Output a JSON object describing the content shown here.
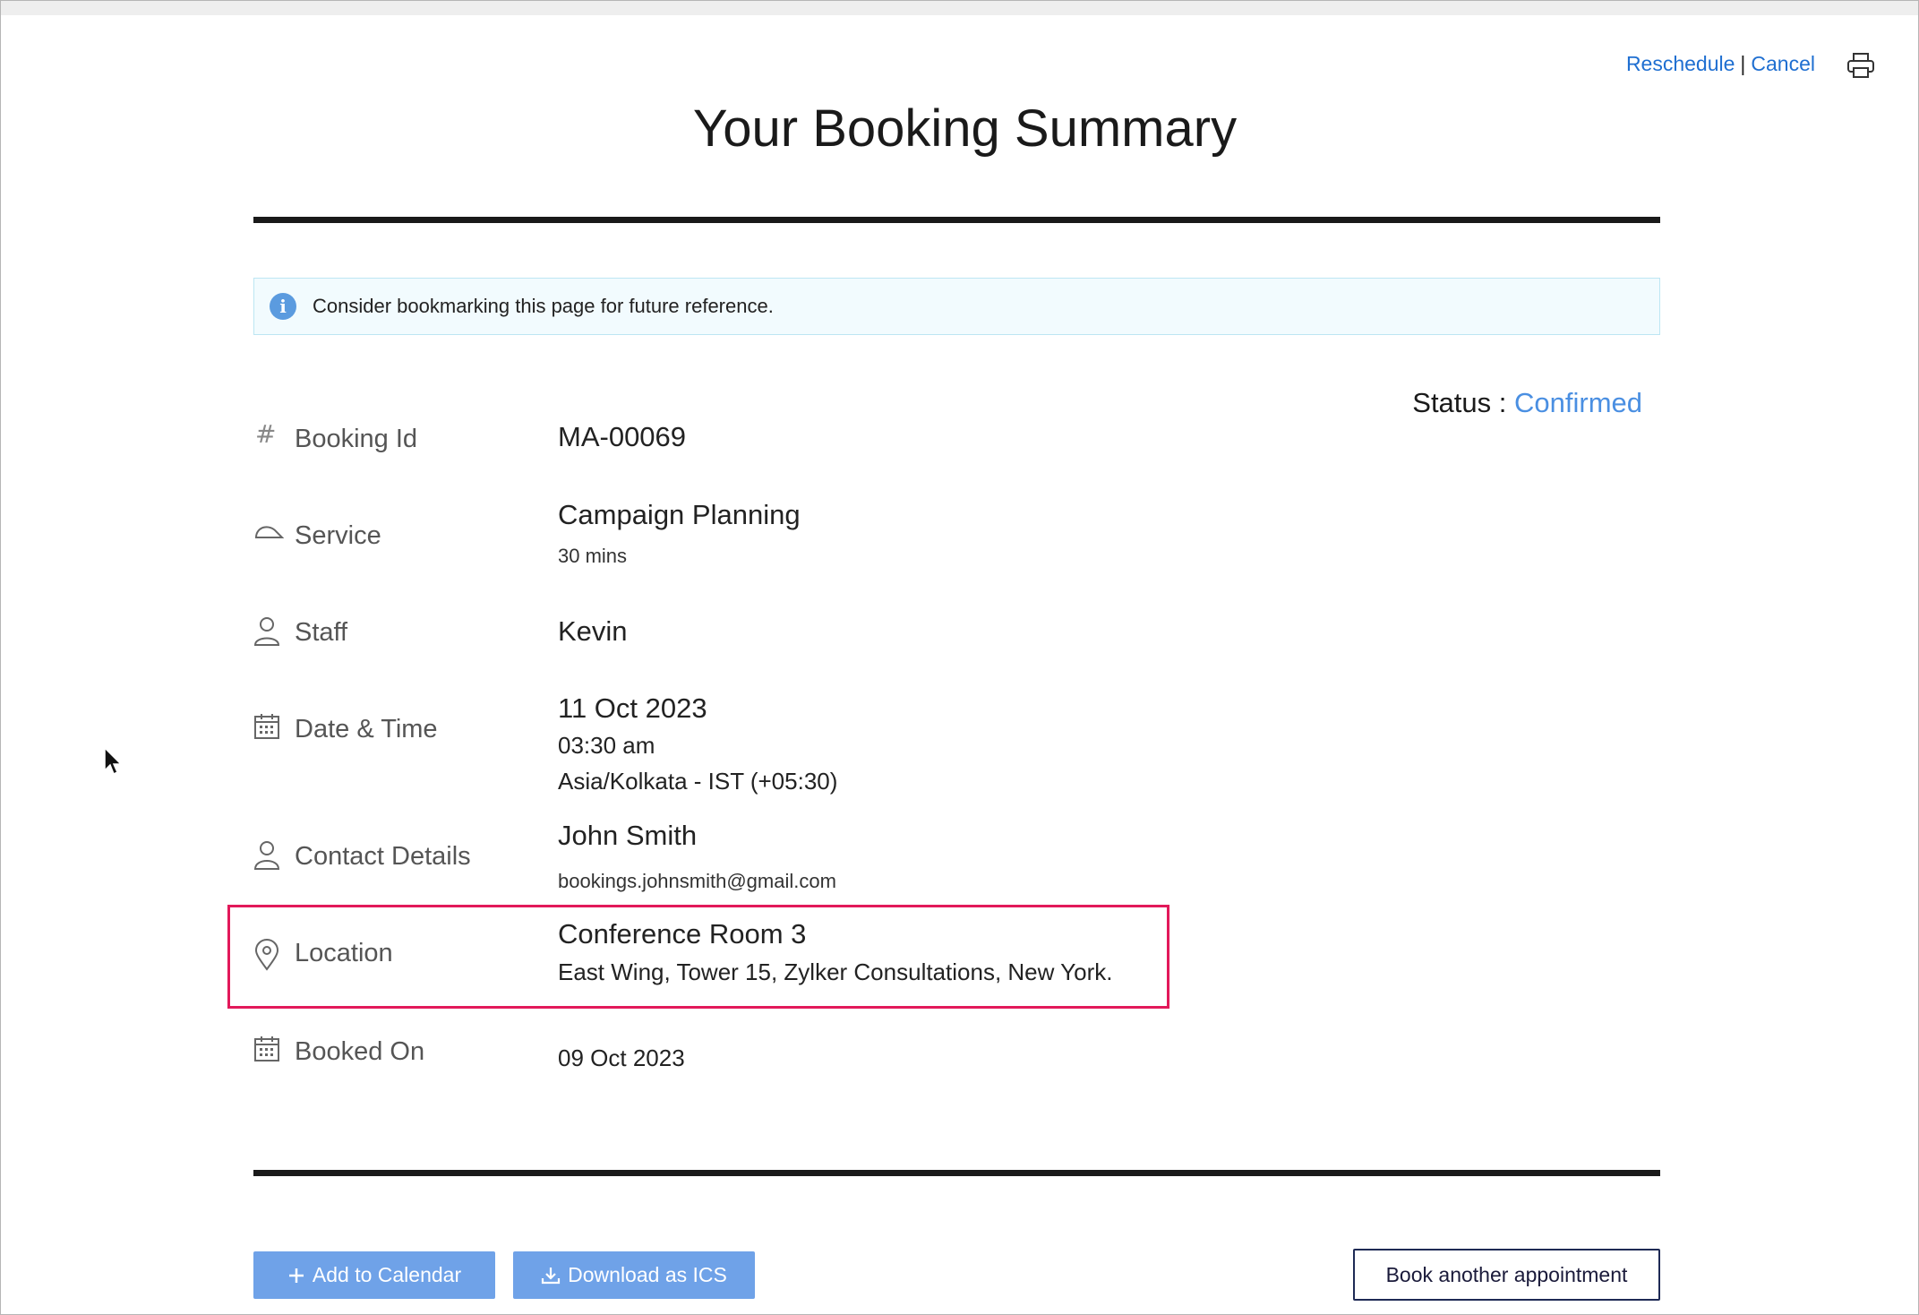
{
  "header": {
    "title": "Your Booking Summary",
    "links": {
      "reschedule": "Reschedule",
      "separator": "|",
      "cancel": "Cancel"
    },
    "print_icon": "printer-icon"
  },
  "notice": {
    "icon": "info-icon",
    "text": "Consider bookmarking this page for future reference."
  },
  "status": {
    "label": "Status :",
    "value": "Confirmed"
  },
  "details": {
    "booking_id": {
      "icon": "hash-icon",
      "label": "Booking Id",
      "value": "MA-00069"
    },
    "service": {
      "icon": "service-cap-icon",
      "label": "Service",
      "value": "Campaign Planning",
      "duration": "30 mins"
    },
    "staff": {
      "icon": "staff-person-icon",
      "label": "Staff",
      "value": "Kevin"
    },
    "datetime": {
      "icon": "calendar-icon",
      "label": "Date & Time",
      "date": "11 Oct 2023",
      "time": "03:30 am",
      "timezone": "Asia/Kolkata - IST (+05:30)"
    },
    "contact": {
      "icon": "user-icon",
      "label": "Contact Details",
      "name": "John Smith",
      "email": "bookings.johnsmith@gmail.com"
    },
    "location": {
      "icon": "location-pin-icon",
      "label": "Location",
      "name": "Conference Room 3",
      "address": "East Wing, Tower 15, Zylker Consultations, New York."
    },
    "booked_on": {
      "icon": "calendar-icon",
      "label": "Booked On",
      "value": "09 Oct 2023"
    }
  },
  "actions": {
    "add_to_calendar": "Add to Calendar",
    "download_ics": "Download as ICS",
    "book_another": "Book another appointment"
  },
  "colors": {
    "link": "#1f6fd1",
    "status": "#4a8fe2",
    "button": "#6fa2e8",
    "highlight": "#e2195a"
  }
}
